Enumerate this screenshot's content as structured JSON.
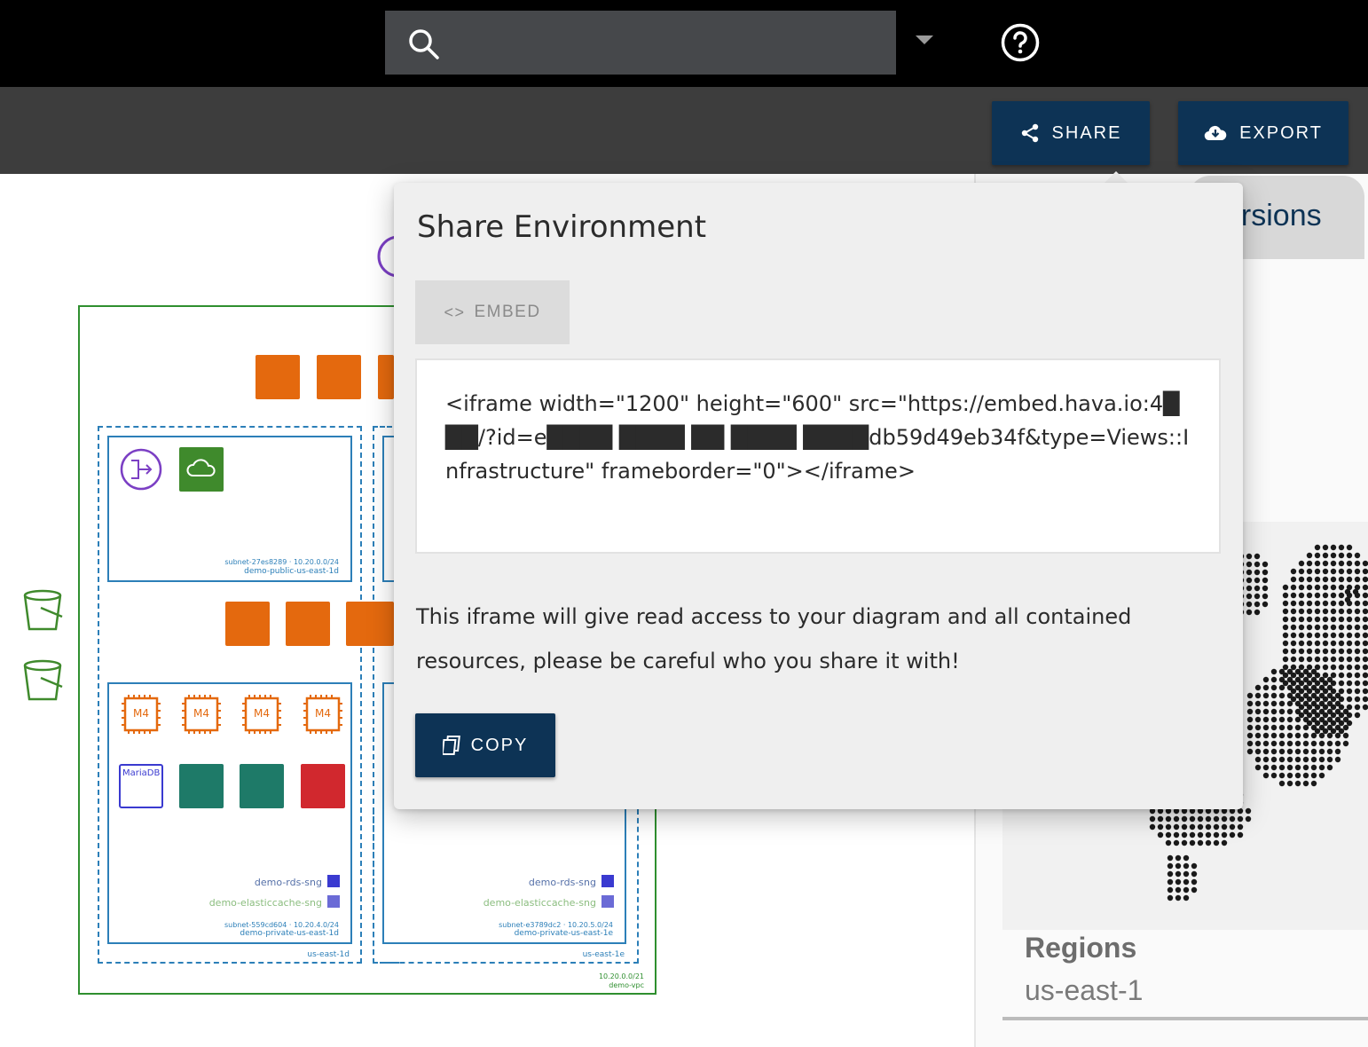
{
  "toolbar": {
    "share_label": "SHARE",
    "export_label": "EXPORT"
  },
  "right_panel": {
    "versions_tab": "ersions",
    "regions_label": "Regions",
    "regions_value": "us-east-1"
  },
  "popover": {
    "title": "Share Environment",
    "embed_tab": "EMBED",
    "embed_code": "<iframe width=\"1200\" height=\"600\" src=\"https://embed.hava.io:4███/?id=e████ ████ ██ ████ ████db59d49eb34f&type=Views::Infrastructure\" frameborder=\"0\"></iframe>",
    "warning": "This iframe will give read access to your diagram and all contained resources, please be careful who you share it with!",
    "copy_label": "COPY"
  },
  "diagram": {
    "vpc_cidr": "10.20.0.0/21",
    "vpc_name": "demo-vpc",
    "az_left": "us-east-1d",
    "az_right": "us-east-1e",
    "subnet_public_left_id": "subnet-27es8289 · 10.20.0.0/24",
    "subnet_public_left_name": "demo-public-us-east-1d",
    "subnet_private_left_id": "subnet-559cd604 · 10.20.4.0/24",
    "subnet_private_left_name": "demo-private-us-east-1d",
    "subnet_private_right_id": "subnet-e3789dc2 · 10.20.5.0/24",
    "subnet_private_right_name": "demo-private-us-east-1e",
    "rds_sng": "demo-rds-sng",
    "elasticache_sng": "demo-elasticcache-sng",
    "ec2_label": "M4",
    "mariadb_label": "MariaDB"
  }
}
